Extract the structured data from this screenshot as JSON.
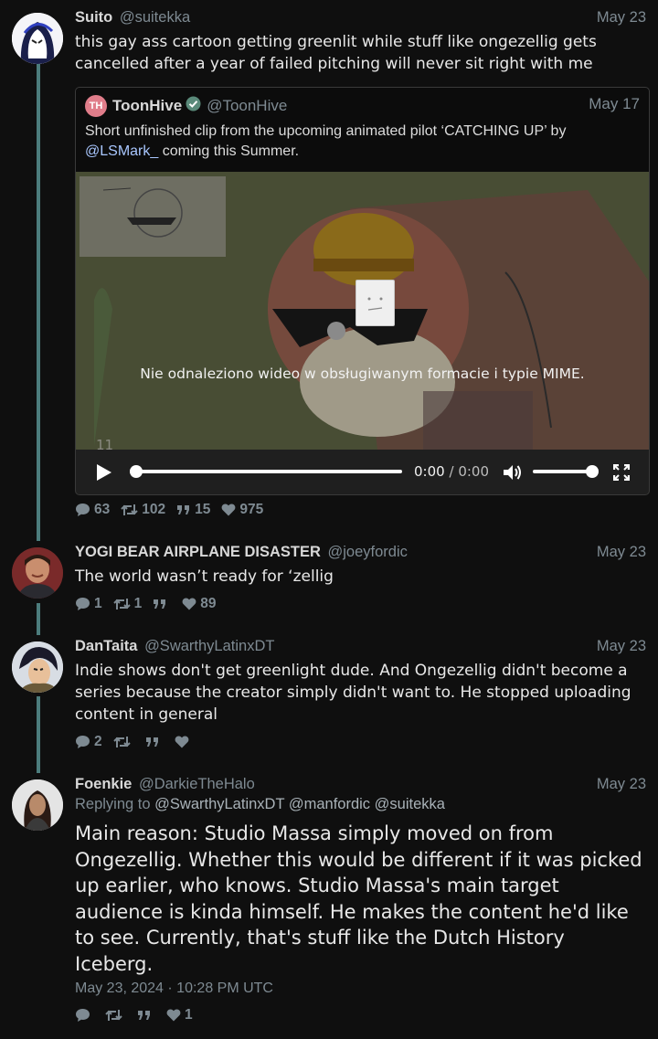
{
  "tweets": [
    {
      "fullname": "Suito",
      "username": "@suitekka",
      "date": "May 23",
      "content": "this gay ass cartoon getting greenlit while stuff like ongezellig gets cancelled after a year of failed pitching will never sit right with me",
      "stats": {
        "replies": "63",
        "retweets": "102",
        "quotes": "15",
        "likes": "975"
      }
    },
    {
      "fullname": "YOGI BEAR AIRPLANE DISASTER",
      "username": "@joeyfordic",
      "date": "May 23",
      "content": "The world wasn’t ready for ‘zellig",
      "stats": {
        "replies": "1",
        "retweets": "1",
        "quotes": "",
        "likes": "89"
      }
    },
    {
      "fullname": "DanTaita",
      "username": "@SwarthyLatinxDT",
      "date": "May 23",
      "content": "Indie shows don't get greenlight dude. And Ongezellig didn't become a series because the creator simply didn't want to. He stopped uploading content in general",
      "stats": {
        "replies": "2",
        "retweets": "",
        "quotes": "",
        "likes": ""
      }
    },
    {
      "fullname": "Foenkie",
      "username": "@DarkieTheHalo",
      "date": "May 23",
      "replying_label": "Replying to",
      "replying_to": [
        "@SwarthyLatinxDT",
        "@manfordic",
        "@suitekka"
      ],
      "content": "Main reason: Studio Massa simply moved on from Ongezellig. Whether this would be different if it was picked up earlier, who knows. Studio Massa's main target audience is kinda himself. He makes the content he'd like to see. Currently, that's stuff like the Dutch History Iceberg.",
      "timestamp": "May 23, 2024 · 10:28 PM UTC",
      "stats": {
        "replies": "",
        "retweets": "",
        "quotes": "",
        "likes": "1"
      }
    }
  ],
  "quote": {
    "avatar_initials": "TH",
    "fullname": "ToonHive",
    "username": "@ToonHive",
    "date": "May 17",
    "text_before": "Short unfinished clip from the upcoming animated pilot ‘CATCHING UP’ by ",
    "mention": "@LSMark_",
    "text_after": " coming this Summer.",
    "video": {
      "error": "Nie odnaleziono wideo w obsługiwanym formacie i typie MIME.",
      "current_time": "0:00",
      "separator": "/",
      "duration": "0:00",
      "progress": 0,
      "volume": 1
    }
  },
  "colors": {
    "thread_line": "#4c7c7c",
    "accent_avatar": "#e07d8a",
    "verified": "#5a8a7a"
  }
}
